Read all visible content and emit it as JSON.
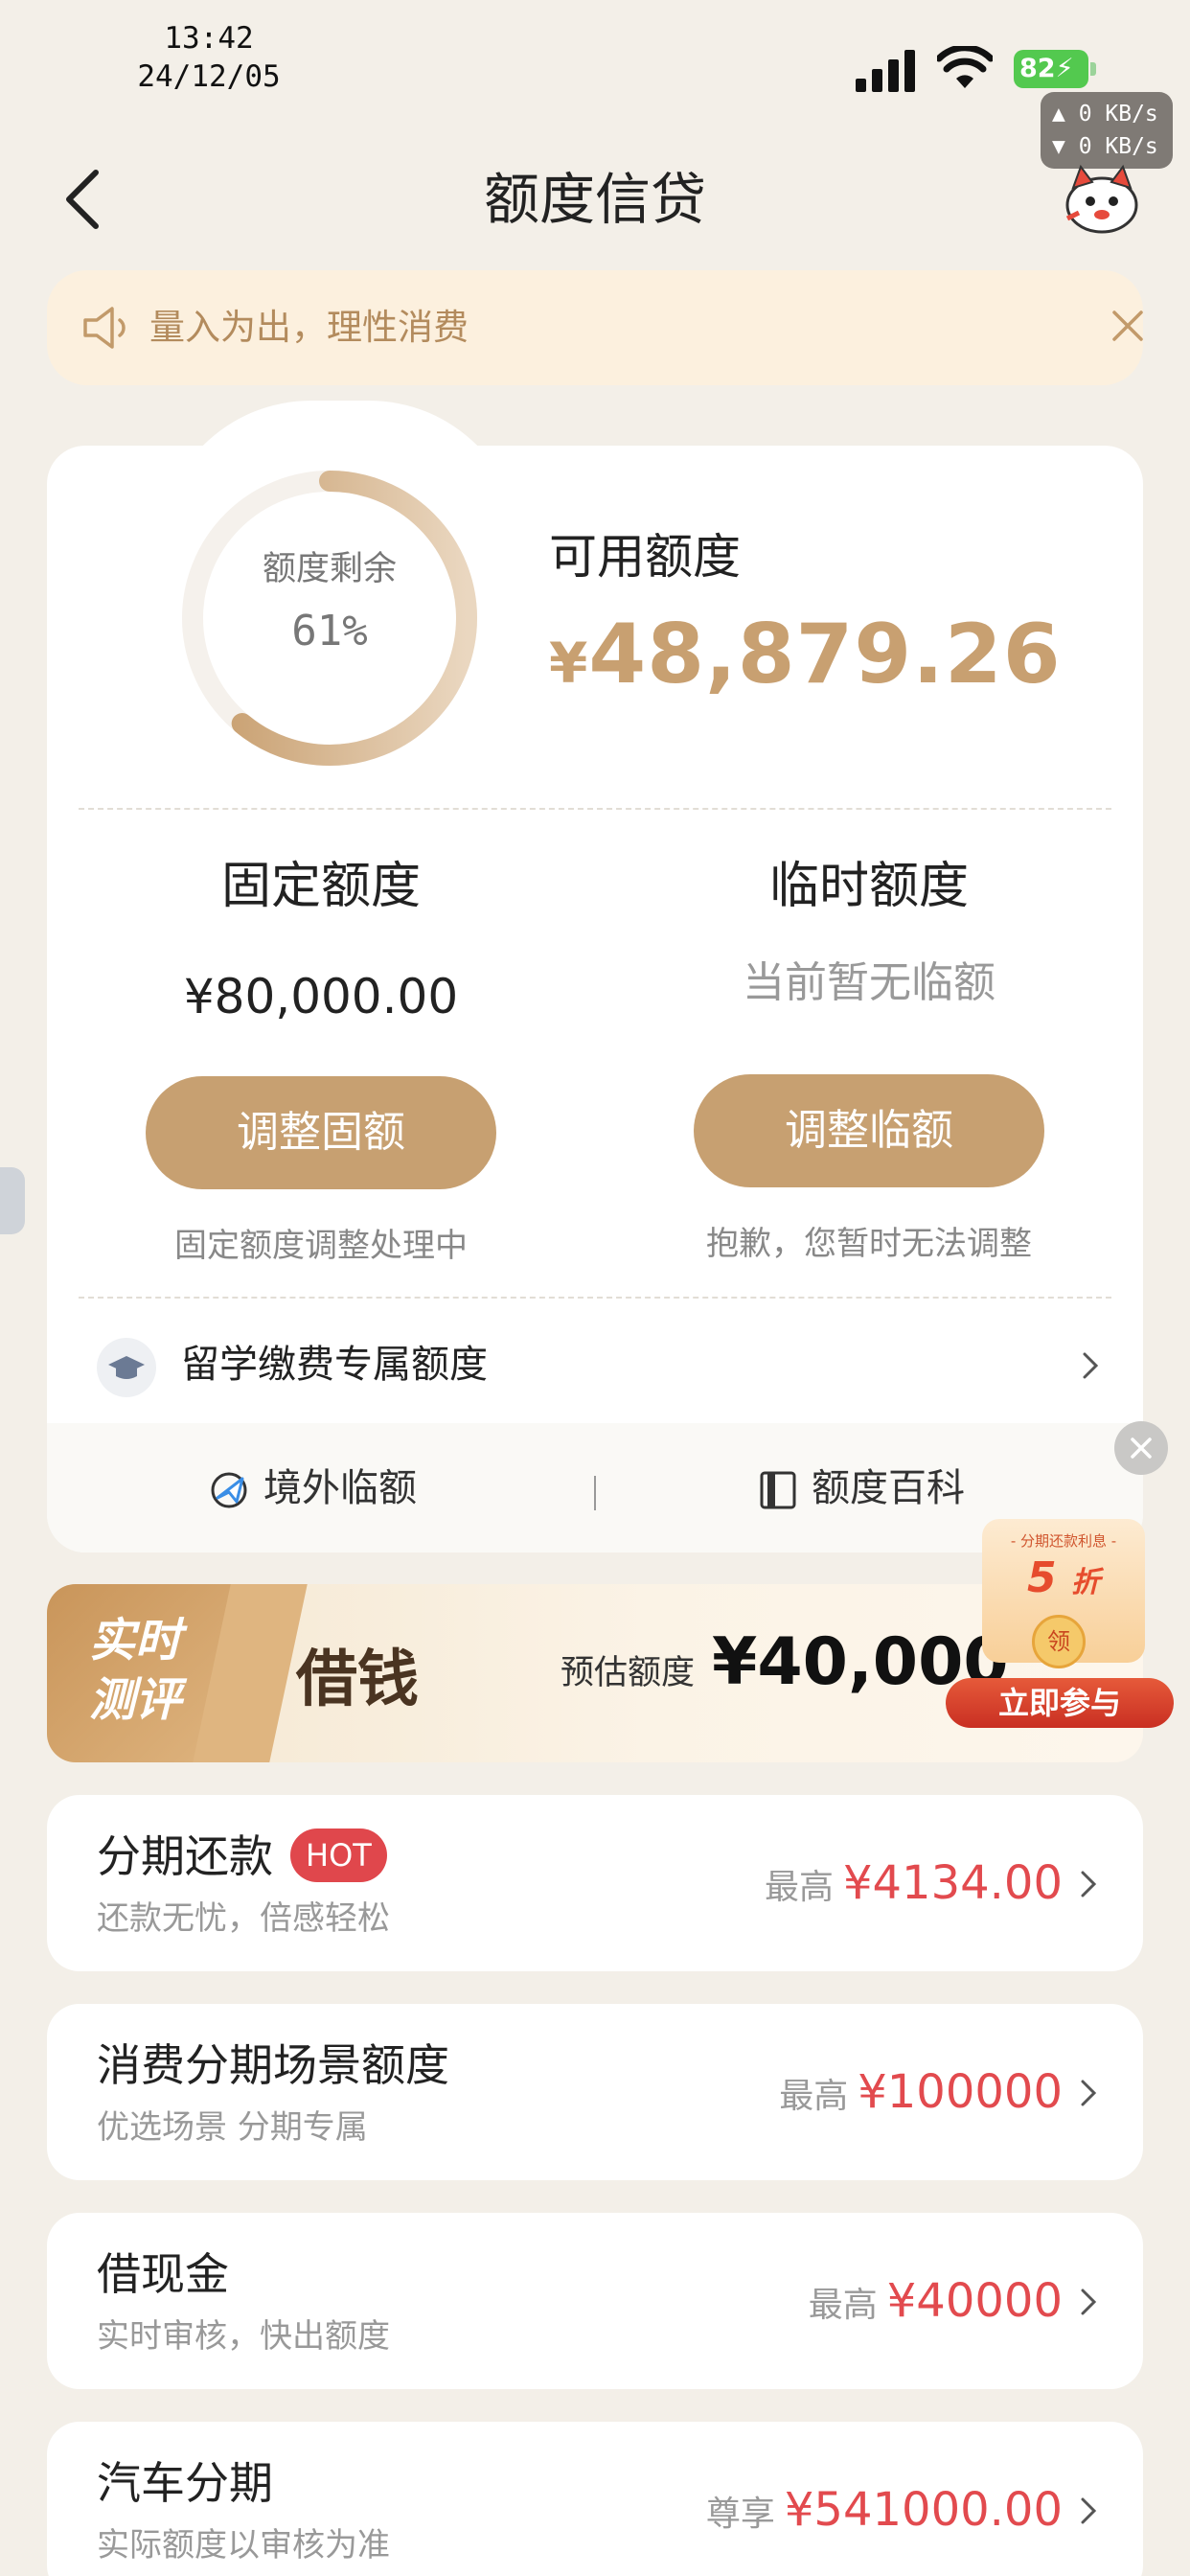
{
  "status_bar": {
    "time": "13:42",
    "date": "24/12/05",
    "battery": "82",
    "net_up": "▲ 0 KB/s",
    "net_down": "▼ 0 KB/s"
  },
  "header": {
    "title": "额度信贷"
  },
  "notice": {
    "text": "量入为出，理性消费"
  },
  "credit": {
    "ring_label": "额度剩余",
    "ring_percent": "61%",
    "ring_fraction": 0.61,
    "available_label": "可用额度",
    "available_currency": "¥",
    "available_amount": "48,879.26",
    "fixed": {
      "label": "固定额度",
      "amount": "¥80,000.00",
      "button": "调整固额",
      "note": "固定额度调整处理中"
    },
    "temporary": {
      "label": "临时额度",
      "status": "当前暂无临额",
      "button": "调整临额",
      "note": "抱歉，您暂时无法调整"
    },
    "study_abroad": "留学缴费专属额度",
    "overseas": "境外临额",
    "encyclopedia": "额度百科"
  },
  "banner": {
    "tag_line1": "实时",
    "tag_line2": "测评",
    "title": "借钱",
    "estimate_label": "预估额度",
    "estimate_amount": "¥40,000"
  },
  "promo": {
    "top_text": "- 分期还款利息 -",
    "discount": "5",
    "discount_unit": "折",
    "coin_text": "领",
    "button": "立即参与"
  },
  "list": [
    {
      "title": "分期还款",
      "badge": "HOT",
      "subtitle": "还款无忧，倍感轻松",
      "prefix": "最高",
      "amount": "¥4134.00"
    },
    {
      "title": "消费分期场景额度",
      "subtitle": "优选场景 分期专属",
      "prefix": "最高",
      "amount": "¥100000"
    },
    {
      "title": "借现金",
      "subtitle": "实时审核，快出额度",
      "prefix": "最高",
      "amount": "¥40000"
    },
    {
      "title": "汽车分期",
      "subtitle": "实际额度以审核为准",
      "prefix": "尊享",
      "amount": "¥541000.00"
    }
  ],
  "colors": {
    "accent_gold": "#c7a071",
    "amount_red": "#e24a4e",
    "hot_badge": "#e0474c",
    "notice_bg": "#fcf0de",
    "page_bg": "#f3efe8"
  }
}
